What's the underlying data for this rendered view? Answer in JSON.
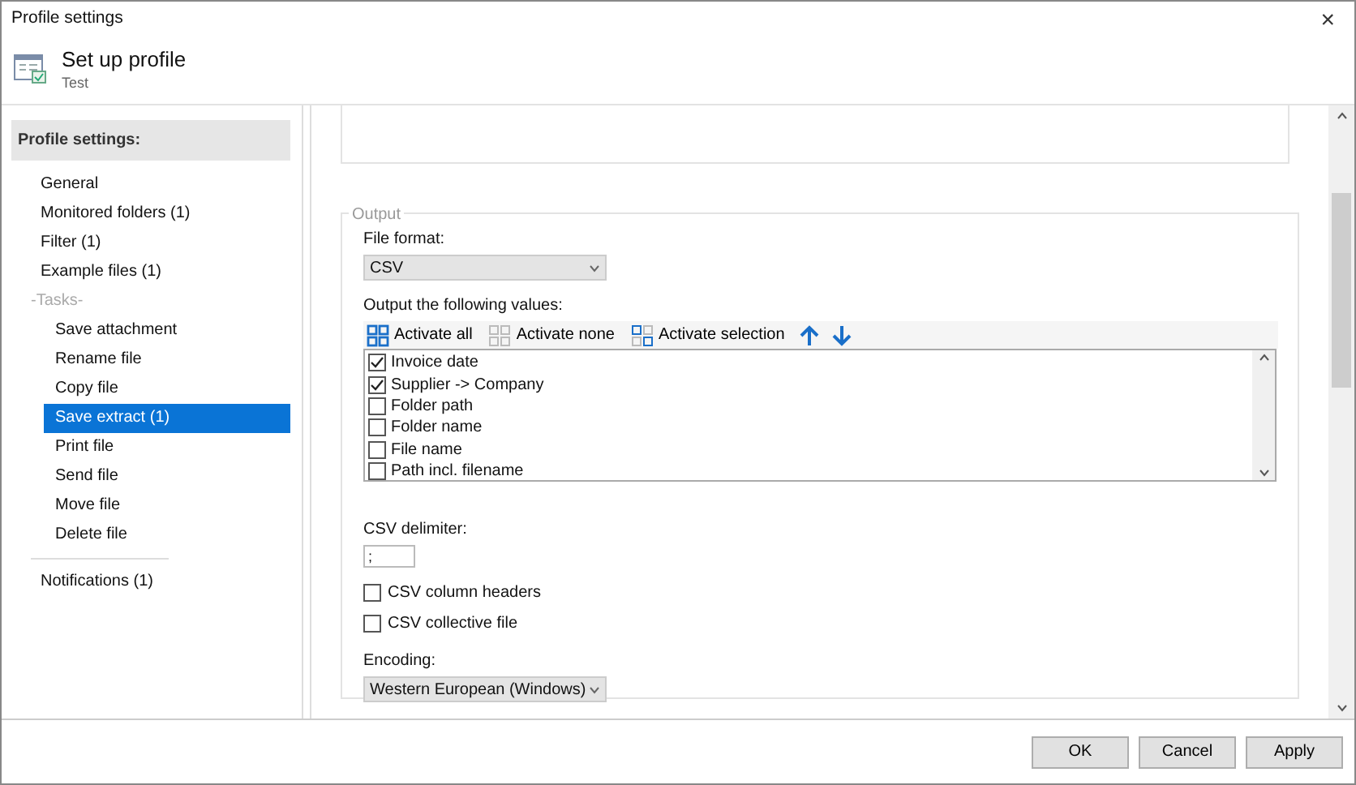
{
  "window": {
    "title": "Profile settings",
    "close": "×"
  },
  "header": {
    "title": "Set up profile",
    "subtitle": "Test"
  },
  "sidebar": {
    "heading": "Profile settings:",
    "items": [
      {
        "kind": "item",
        "label": "General",
        "selected": false
      },
      {
        "kind": "item",
        "label": "Monitored folders (1)",
        "selected": false
      },
      {
        "kind": "item",
        "label": "Filter (1)",
        "selected": false
      },
      {
        "kind": "item",
        "label": "Example files (1)",
        "selected": false
      },
      {
        "kind": "group",
        "label": "-Tasks-"
      },
      {
        "kind": "subitem",
        "label": "Save attachment",
        "selected": false
      },
      {
        "kind": "subitem",
        "label": "Rename file",
        "selected": false
      },
      {
        "kind": "subitem",
        "label": "Copy file",
        "selected": false
      },
      {
        "kind": "subitem",
        "label": "Save extract (1)",
        "selected": true
      },
      {
        "kind": "subitem",
        "label": "Print file",
        "selected": false
      },
      {
        "kind": "subitem",
        "label": "Send file",
        "selected": false
      },
      {
        "kind": "subitem",
        "label": "Move file",
        "selected": false
      },
      {
        "kind": "subitem",
        "label": "Delete file",
        "selected": false
      },
      {
        "kind": "separator"
      },
      {
        "kind": "item",
        "label": "Notifications (1)",
        "selected": false
      }
    ]
  },
  "output": {
    "legend": "Output",
    "file_format_label": "File format:",
    "file_format": "CSV",
    "values_label": "Output the following values:",
    "toolbar": [
      {
        "kind": "all",
        "label": "Activate all"
      },
      {
        "kind": "none",
        "label": "Activate none"
      },
      {
        "kind": "selection",
        "label": "Activate selection"
      },
      {
        "kind": "up"
      },
      {
        "kind": "down"
      }
    ],
    "values": [
      {
        "label": "Invoice date",
        "checked": true
      },
      {
        "label": "Supplier -> Company",
        "checked": true
      },
      {
        "label": "Folder path",
        "checked": false
      },
      {
        "label": "Folder name",
        "checked": false
      },
      {
        "label": "File name",
        "checked": false
      },
      {
        "label": "Path incl. filename",
        "checked": false
      }
    ],
    "delimiter_label": "CSV delimiter:",
    "delimiter": ";",
    "options": [
      {
        "label": "CSV column headers",
        "checked": false
      },
      {
        "label": "CSV collective file",
        "checked": false
      }
    ],
    "encoding_label": "Encoding:",
    "encoding": "Western European (Windows)"
  },
  "buttons": [
    "OK",
    "Cancel",
    "Apply"
  ]
}
